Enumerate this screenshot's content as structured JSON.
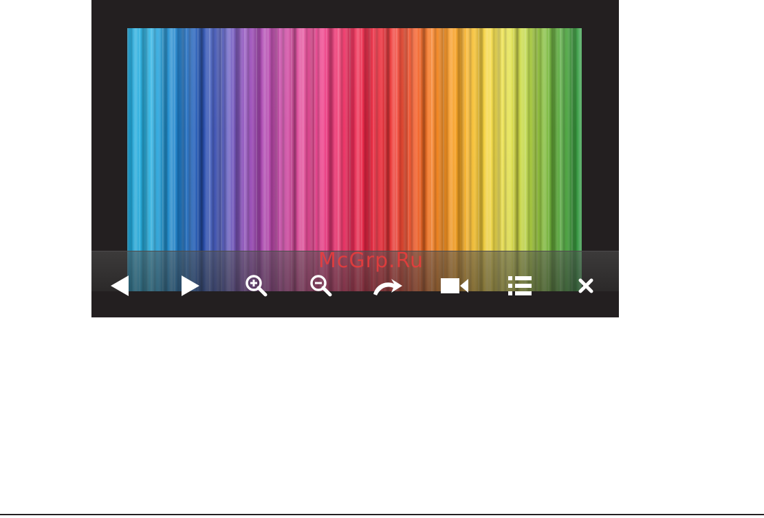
{
  "viewer": {
    "photo_description_icon": "image-content",
    "toolbar": {
      "buttons": [
        {
          "name": "previous",
          "icon": "triangle-left-icon"
        },
        {
          "name": "next",
          "icon": "triangle-right-icon"
        },
        {
          "name": "zoom-in",
          "icon": "zoom-in-icon"
        },
        {
          "name": "zoom-out",
          "icon": "zoom-out-icon"
        },
        {
          "name": "rotate",
          "icon": "rotate-arrow-icon"
        },
        {
          "name": "video",
          "icon": "video-camera-icon"
        },
        {
          "name": "list",
          "icon": "list-icon"
        },
        {
          "name": "close",
          "icon": "close-icon"
        }
      ],
      "icon_color": "#ffffff"
    }
  },
  "watermark": {
    "text": "McGrp.Ru",
    "color": "#ec3c3c"
  }
}
